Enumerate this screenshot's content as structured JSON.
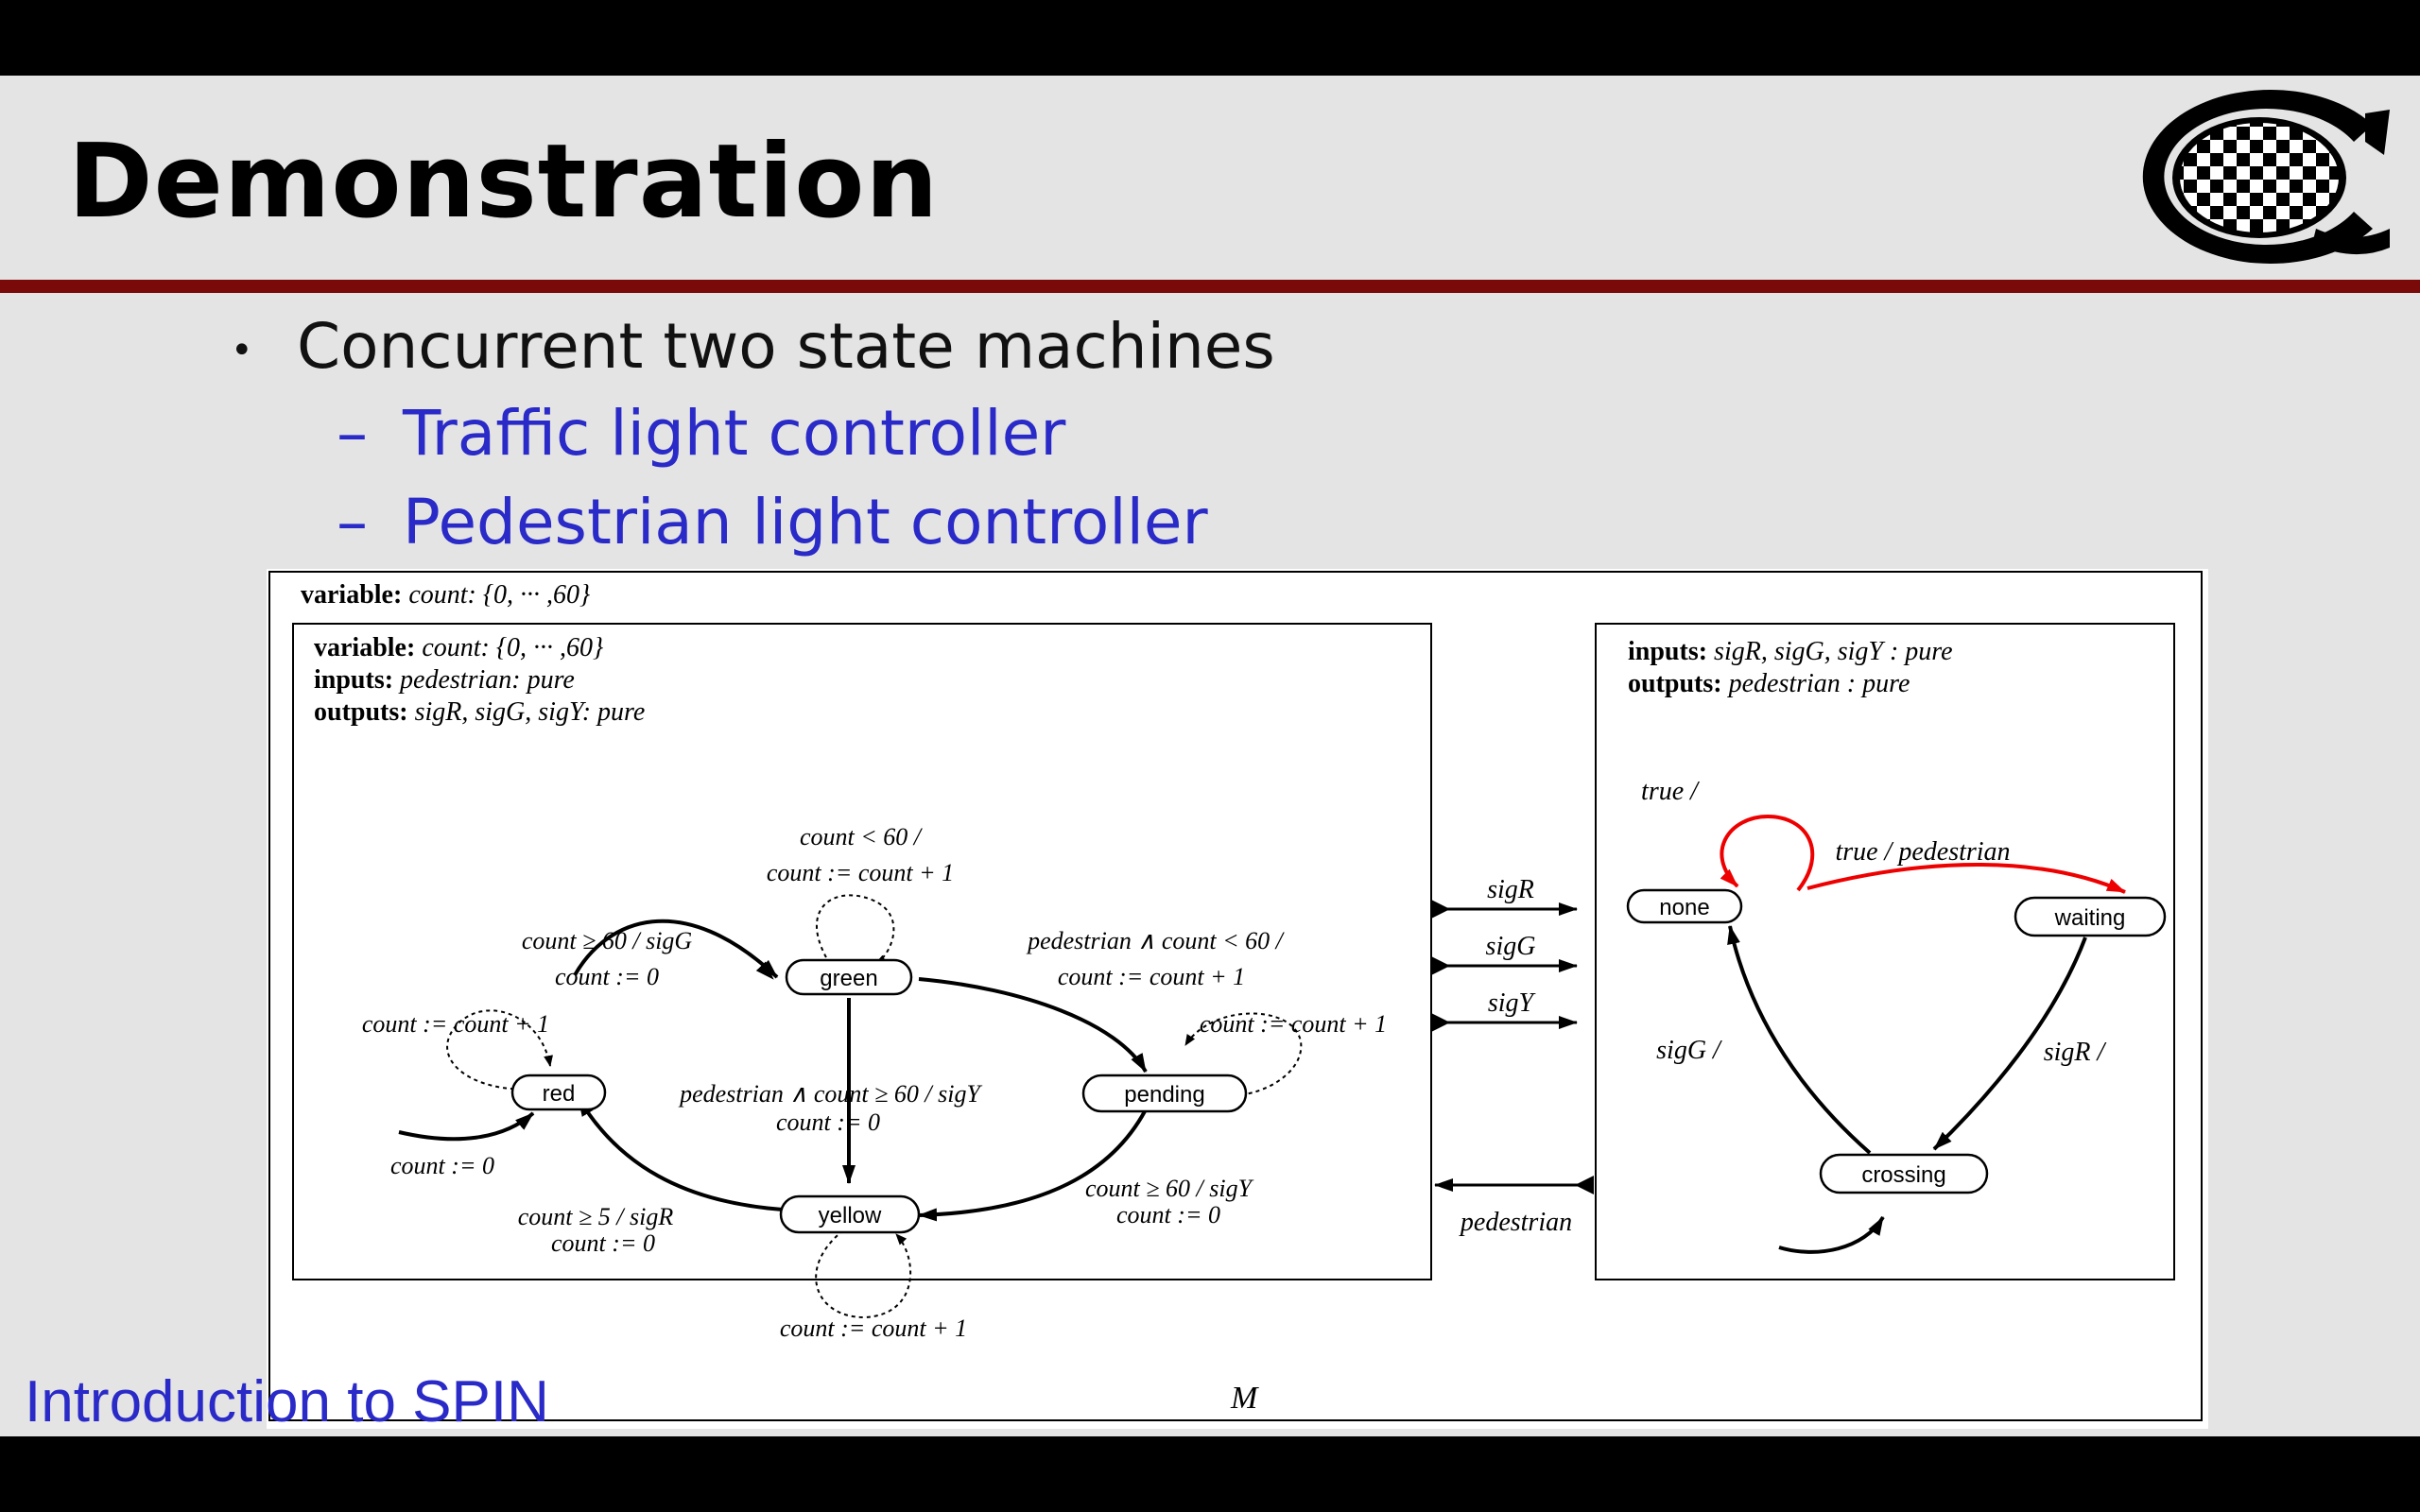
{
  "slide": {
    "title": "Demonstration",
    "bullet": "Concurrent two state machines",
    "subbullets": [
      "Traffic light controller",
      "Pedestrian light controller"
    ],
    "footer": "Introduction to SPIN"
  },
  "diagram": {
    "outer_label": "M",
    "outer_variable": {
      "key": "variable:",
      "rest": "count: {0, ··· ,60}"
    },
    "traffic": {
      "header": [
        {
          "key": "variable:",
          "rest": "count: {0, ··· ,60}"
        },
        {
          "key": "inputs:",
          "rest": "pedestrian: pure"
        },
        {
          "key": "outputs:",
          "rest": "sigR, sigG, sigY: pure"
        }
      ],
      "states": {
        "red": "red",
        "green": "green",
        "pending": "pending",
        "yellow": "yellow"
      },
      "labels": {
        "green_self_1": "count < 60 /",
        "green_self_2": "count := count + 1",
        "red_green_1": "count ≥ 60 / sigG",
        "red_green_2": "count := 0",
        "red_self": "count := count + 1",
        "red_init": "count := 0",
        "green_pending_1": "pedestrian ∧ count < 60 /",
        "green_pending_2": "count := count + 1",
        "pending_self": "count := count + 1",
        "green_yellow_1": "pedestrian ∧ count ≥ 60 / sigY",
        "green_yellow_2": "count := 0",
        "pending_yellow_1": "count ≥ 60 / sigY",
        "pending_yellow_2": "count := 0",
        "yellow_red_1": "count ≥ 5 / sigR",
        "yellow_red_2": "count := 0",
        "yellow_self": "count := count + 1"
      }
    },
    "connectors": {
      "sigR": "sigR",
      "sigG": "sigG",
      "sigY": "sigY",
      "pedestrian": "pedestrian"
    },
    "pedestrian_machine": {
      "header": [
        {
          "key": "inputs:",
          "rest": "sigR, sigG, sigY : pure"
        },
        {
          "key": "outputs:",
          "rest": "pedestrian : pure"
        }
      ],
      "states": {
        "none": "none",
        "waiting": "waiting",
        "crossing": "crossing"
      },
      "labels": {
        "none_self": "true /",
        "none_waiting": "true / pedestrian",
        "crossing_none": "sigG /",
        "waiting_crossing": "sigR /"
      }
    }
  }
}
